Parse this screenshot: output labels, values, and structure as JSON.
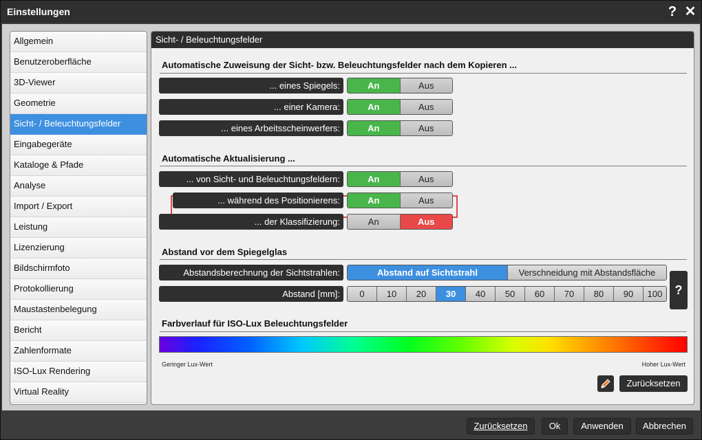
{
  "window": {
    "title": "Einstellungen",
    "help_glyph": "?",
    "close_glyph": "✕"
  },
  "sidebar": {
    "items": [
      {
        "label": "Allgemein"
      },
      {
        "label": "Benutzeroberfläche"
      },
      {
        "label": "3D-Viewer"
      },
      {
        "label": "Geometrie"
      },
      {
        "label": "Sicht- / Beleuchtungsfelder",
        "active": true
      },
      {
        "label": "Eingabegeräte"
      },
      {
        "label": "Kataloge & Pfade"
      },
      {
        "label": "Analyse"
      },
      {
        "label": "Import / Export"
      },
      {
        "label": "Leistung"
      },
      {
        "label": "Lizenzierung"
      },
      {
        "label": "Bildschirmfoto"
      },
      {
        "label": "Protokollierung"
      },
      {
        "label": "Maustastenbelegung"
      },
      {
        "label": "Bericht"
      },
      {
        "label": "Zahlenformate"
      },
      {
        "label": "ISO-Lux Rendering"
      },
      {
        "label": "Virtual Reality"
      }
    ]
  },
  "panel": {
    "header": "Sicht- / Beleuchtungsfelder",
    "section1": {
      "title": "Automatische Zuweisung der Sicht- bzw. Beleuchtungsfelder nach dem Kopieren ...",
      "rows": [
        {
          "label": "... eines Spiegels:",
          "on": "An",
          "off": "Aus",
          "state": "on"
        },
        {
          "label": "... einer Kamera:",
          "on": "An",
          "off": "Aus",
          "state": "on"
        },
        {
          "label": "... eines Arbeitsscheinwerfers:",
          "on": "An",
          "off": "Aus",
          "state": "on"
        }
      ]
    },
    "section2": {
      "title": "Automatische Aktualisierung ...",
      "rows": [
        {
          "label": "... von Sicht- und Beleuchtungsfeldern:",
          "on": "An",
          "off": "Aus",
          "state": "on"
        },
        {
          "label": "... während des Positionierens:",
          "on": "An",
          "off": "Aus",
          "state": "on"
        },
        {
          "label": "... der Klassifizierung:",
          "on": "An",
          "off": "Aus",
          "state": "off"
        }
      ]
    },
    "section3": {
      "title": "Abstand vor dem Spiegelglas",
      "calc_label": "Abstandsberechnung der Sichtstrahlen:",
      "calc_options": [
        "Abstand auf Sichtstrahl",
        "Verschneidung mit Abstandsfläche"
      ],
      "calc_selected": "Abstand auf Sichtstrahl",
      "distance_label": "Abstand [mm]:",
      "distance_options": [
        "0",
        "10",
        "20",
        "30",
        "40",
        "50",
        "60",
        "70",
        "80",
        "90",
        "100"
      ],
      "distance_selected": "30",
      "help_glyph": "?"
    },
    "section4": {
      "title": "Farbverlauf für ISO-Lux Beleuchtungsfelder",
      "low_label": "Geringer Lux-Wert",
      "high_label": "Hoher Lux-Wert",
      "reset_label": "Zurücksetzen",
      "edit_icon": "pencil-icon"
    }
  },
  "footer": {
    "reset_label": "Zurücksetzen",
    "ok_label": "Ok",
    "apply_label": "Anwenden",
    "cancel_label": "Abbrechen"
  },
  "colors": {
    "accent_blue": "#3d8fe0",
    "on_green": "#48b64a",
    "off_red": "#e94848",
    "dark": "#2f2f2f",
    "highlight": "#e04848"
  }
}
